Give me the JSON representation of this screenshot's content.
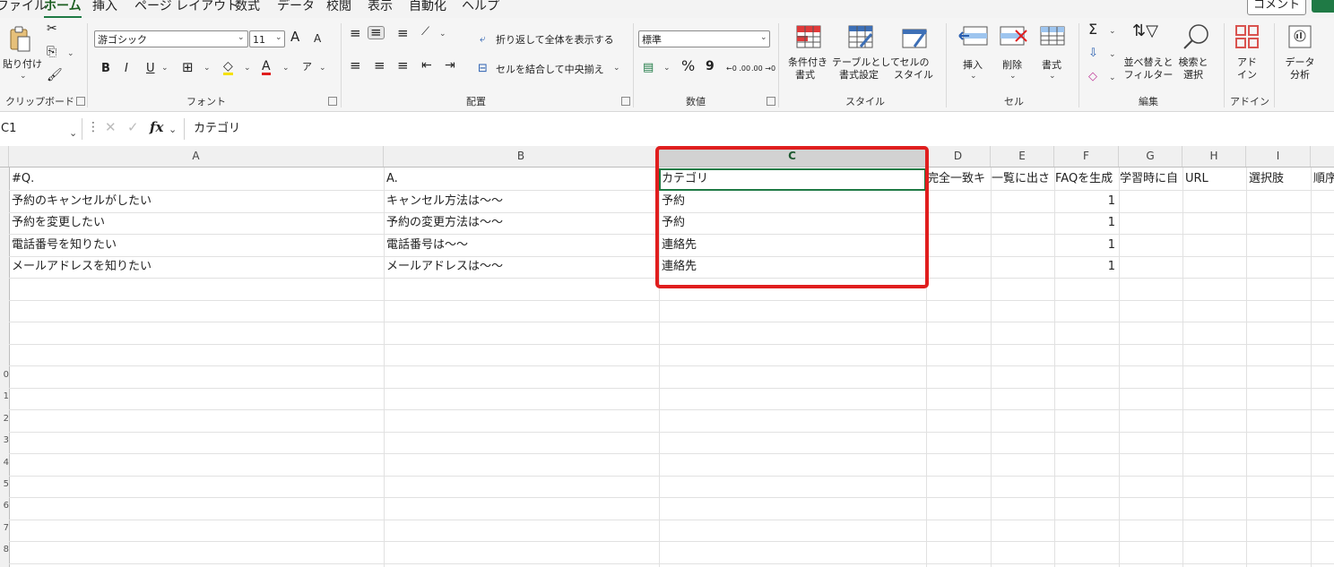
{
  "menu": {
    "items": [
      "ファイル",
      "ホーム",
      "挿入",
      "ページ レイアウト",
      "数式",
      "データ",
      "校閲",
      "表示",
      "自動化",
      "ヘルプ"
    ],
    "active": "ホーム",
    "comment": "コメント"
  },
  "ribbon": {
    "clipboard": {
      "group": "クリップボード",
      "paste": "貼り付け"
    },
    "font": {
      "group": "フォント",
      "name": "游ゴシック",
      "size": "11",
      "bold": "B",
      "italic": "I",
      "underline": "U",
      "grow": "A",
      "shrink": "A",
      "color_letter": "A"
    },
    "alignment": {
      "group": "配置",
      "wrap": "折り返して全体を表示する",
      "merge": "セルを結合して中央揃え"
    },
    "number": {
      "group": "数値",
      "format": "標準",
      "percent": "%",
      "comma": "9",
      "inc": "←0 .00",
      "dec": ".00 →0"
    },
    "styles": {
      "group": "スタイル",
      "conditional": [
        "条件付き",
        "書式"
      ],
      "table": [
        "テーブルとして",
        "書式設定"
      ],
      "cell": [
        "セルの",
        "スタイル"
      ]
    },
    "cells": {
      "group": "セル",
      "insert": "挿入",
      "delete": "削除",
      "format": "書式"
    },
    "editing": {
      "group": "編集",
      "sort": [
        "並べ替えと",
        "フィルター"
      ],
      "find": [
        "検索と",
        "選択"
      ]
    },
    "addins": {
      "group": "アドイン",
      "addin": [
        "アド",
        "イン"
      ],
      "analyze": [
        "データ",
        "分析"
      ]
    }
  },
  "formula_bar": {
    "name_box": "C1",
    "fx": "fx",
    "value": "カテゴリ"
  },
  "sheet": {
    "columns": [
      "A",
      "B",
      "C",
      "D",
      "E",
      "F",
      "G",
      "H",
      "I"
    ],
    "selected_column": "C",
    "row_numbers": [
      "0",
      "1",
      "2",
      "3",
      "4",
      "5",
      "6",
      "7",
      "8"
    ],
    "rows": [
      [
        "#Q.",
        "A.",
        "カテゴリ",
        "完全一致キ",
        "一覧に出さ",
        "FAQを生成",
        "学習時に自",
        "URL",
        "選択肢",
        "順序"
      ],
      [
        "予約のキャンセルがしたい",
        "キャンセル方法は～～",
        "予約",
        "",
        "",
        "1",
        "",
        "",
        "",
        ""
      ],
      [
        "予約を変更したい",
        "予約の変更方法は～～",
        "予約",
        "",
        "",
        "1",
        "",
        "",
        "",
        ""
      ],
      [
        "電話番号を知りたい",
        "電話番号は～～",
        "連絡先",
        "",
        "",
        "1",
        "",
        "",
        "",
        ""
      ],
      [
        "メールアドレスを知りたい",
        "メールアドレスは～～",
        "連絡先",
        "",
        "",
        "1",
        "",
        "",
        "",
        ""
      ]
    ]
  },
  "colors": {
    "accent": "#1f7a45",
    "highlight": "#e01e1e"
  }
}
